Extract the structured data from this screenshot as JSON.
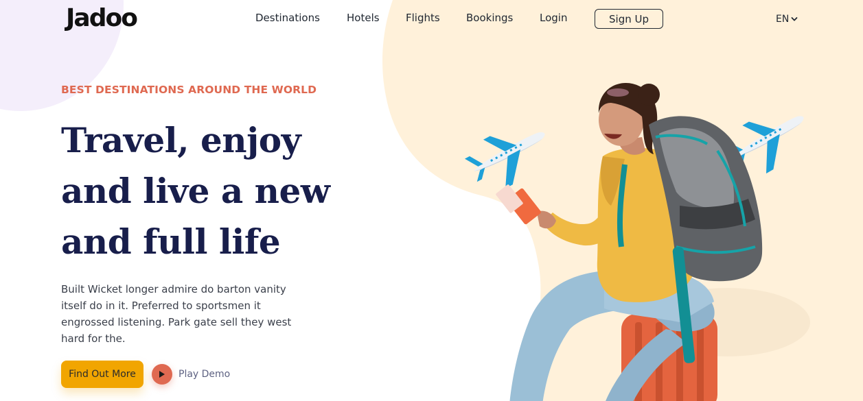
{
  "brand": {
    "logo": "Jadoo"
  },
  "nav": {
    "links": [
      "Destinations",
      "Hotels",
      "Flights",
      "Bookings",
      "Login"
    ],
    "signup": "Sign Up",
    "language": "EN"
  },
  "hero": {
    "eyebrow": "BEST DESTINATIONS AROUND THE WORLD",
    "headline": [
      "Travel, enjoy",
      "and live a new",
      "and full life"
    ],
    "description": "Built Wicket longer admire do barton vanity itself do in it. Preferred to sportsmen it engrossed listening. Park gate sell they west hard for the.",
    "cta_label": "Find Out More",
    "play_label": "Play Demo"
  },
  "colors": {
    "accent": "#df6951",
    "cta": "#f1a501",
    "heading": "#181e4b",
    "peach_bg": "#fff1da",
    "lavender": "#f4eefb"
  },
  "icons": [
    "chevron-down-icon",
    "play-icon",
    "airplane-icon"
  ]
}
